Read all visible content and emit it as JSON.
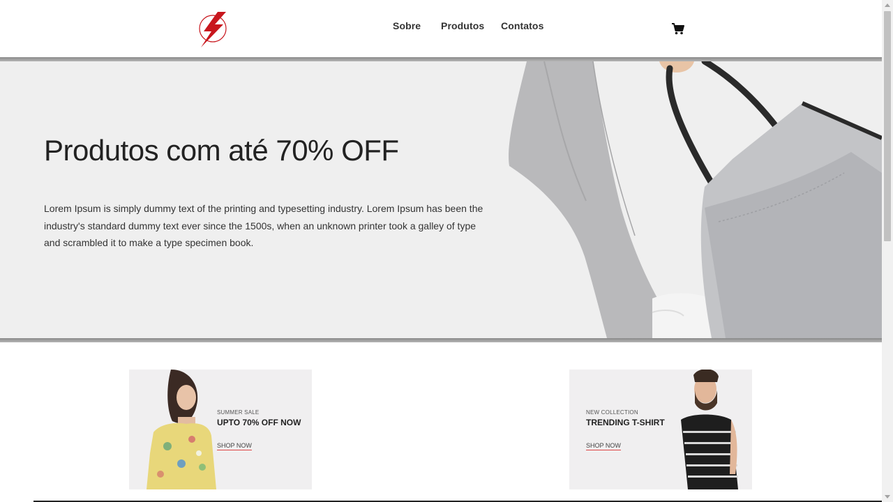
{
  "nav": {
    "items": [
      {
        "label": "Sobre"
      },
      {
        "label": "Produtos"
      },
      {
        "label": "Contatos"
      }
    ]
  },
  "icons": {
    "logo": "lightning-bolt-logo-icon",
    "cart": "shopping-cart-icon"
  },
  "hero": {
    "title": "Produtos com até 70% OFF",
    "text": "Lorem Ipsum is simply dummy text of the printing and typesetting industry. Lorem Ipsum has been the industry's standard dummy text ever since the 1500s, when an unknown printer took a galley of type and scrambled it to make a type specimen book."
  },
  "cards": [
    {
      "kicker": "SUMMER SALE",
      "headline": "UPTO 70% OFF NOW",
      "cta": "SHOP NOW"
    },
    {
      "kicker": "NEW COLLECTION",
      "headline": "TRENDING T-SHIRT",
      "cta": "SHOP NOW"
    }
  ],
  "colors": {
    "logo_red": "#c8161d",
    "hero_bg": "#efefef",
    "accent_underline": "#dd4444"
  }
}
